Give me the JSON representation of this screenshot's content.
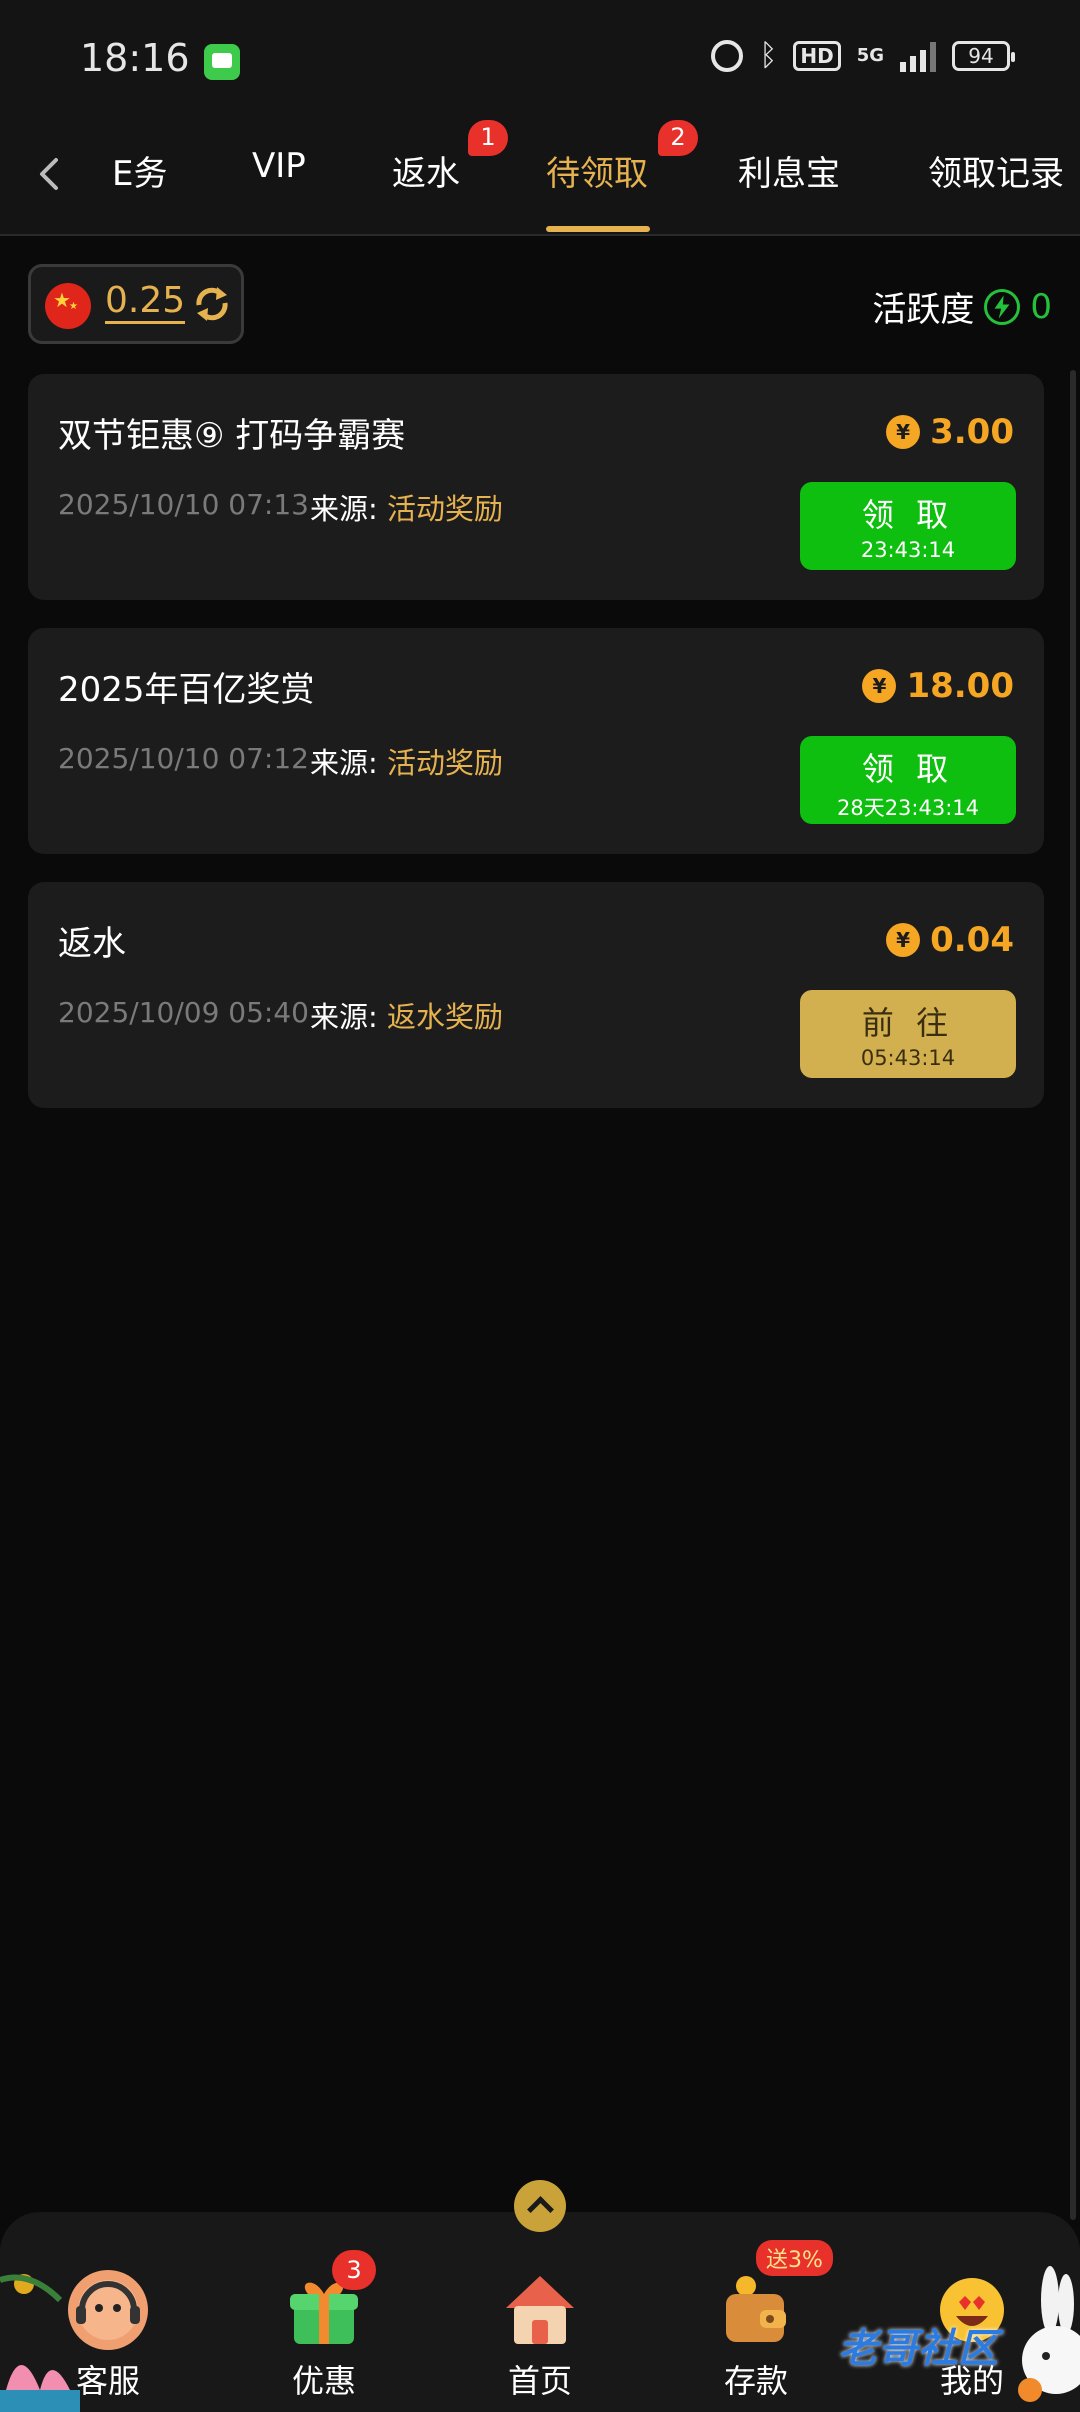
{
  "status_bar": {
    "time": "18:16",
    "network": "5G",
    "hd": "HD",
    "battery": "94"
  },
  "tabs": [
    {
      "label": "任务",
      "visible_label": "E务",
      "badge": ""
    },
    {
      "label": "VIP",
      "badge": ""
    },
    {
      "label": "返水",
      "badge": "1"
    },
    {
      "label": "待领取",
      "badge": "2",
      "active": true
    },
    {
      "label": "利息宝",
      "badge": ""
    },
    {
      "label": "领取记录",
      "badge": ""
    }
  ],
  "balance": {
    "value": "0.25"
  },
  "activity": {
    "label": "活跃度",
    "value": "0"
  },
  "rewards": [
    {
      "title": "双节钜惠⑨ 打码争霸赛",
      "amount": "3.00",
      "date": "2025/10/10 07:13",
      "source_label": "来源:",
      "source": "活动奖励",
      "button_label": "领 取",
      "button_timer": "23:43:14",
      "button_style": "green"
    },
    {
      "title": "2025年百亿奖赏",
      "amount": "18.00",
      "date": "2025/10/10 07:12",
      "source_label": "来源:",
      "source": "活动奖励",
      "button_label": "领 取",
      "button_timer": "28天23:43:14",
      "button_style": "green"
    },
    {
      "title": "返水",
      "amount": "0.04",
      "date": "2025/10/09 05:40",
      "source_label": "来源:",
      "source": "返水奖励",
      "button_label": "前 往",
      "button_timer": "05:43:14",
      "button_style": "gold"
    }
  ],
  "bottom_nav": [
    {
      "label": "客服",
      "icon": "headset-avatar-icon",
      "badge": ""
    },
    {
      "label": "优惠",
      "icon": "gift-icon",
      "badge": "3"
    },
    {
      "label": "首页",
      "icon": "home-icon",
      "badge": ""
    },
    {
      "label": "存款",
      "icon": "wallet-icon",
      "badge": "送3%"
    },
    {
      "label": "我的",
      "icon": "smiley-icon",
      "badge": ""
    }
  ],
  "watermark": "老哥社区",
  "colors": {
    "accent_gold": "#e6b24f",
    "claim_green": "#0fbf10",
    "amount_orange": "#f5a623",
    "badge_red": "#e8312b"
  }
}
